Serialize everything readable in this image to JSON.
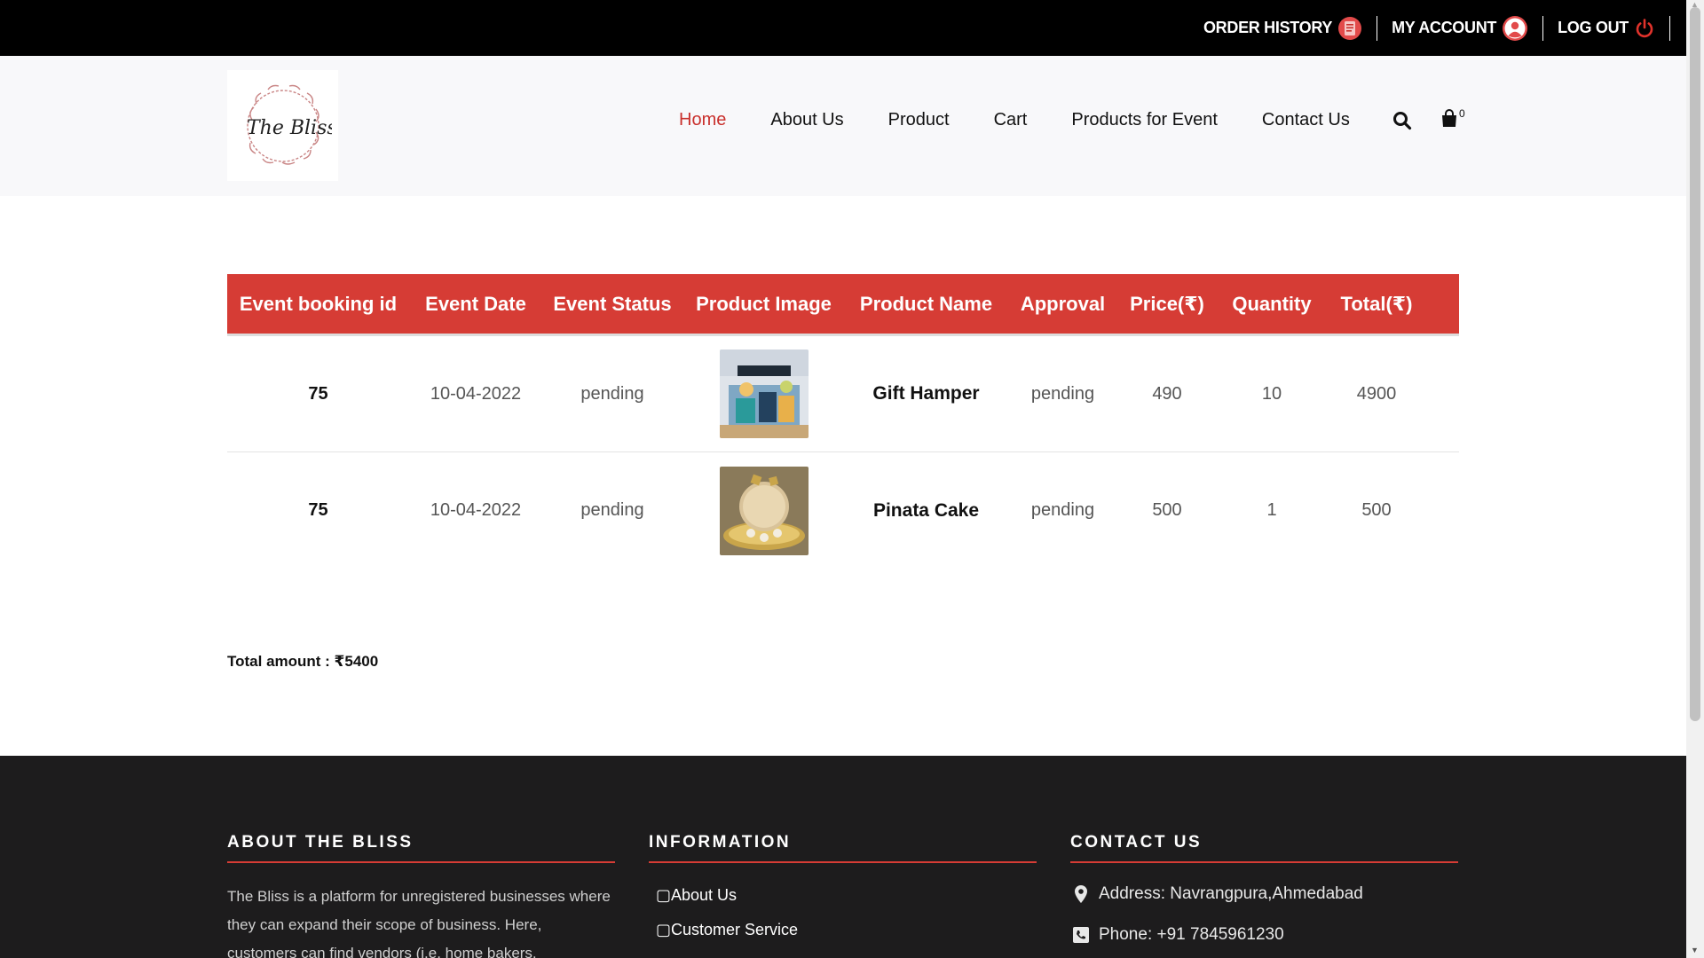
{
  "top_links": [
    {
      "label": "ORDER HISTORY",
      "icon": "order-history-icon"
    },
    {
      "label": "MY ACCOUNT",
      "icon": "user-account-icon"
    },
    {
      "label": "LOG OUT",
      "icon": "power-icon"
    }
  ],
  "logo": {
    "text": "The Bliss"
  },
  "nav": [
    {
      "label": "Home",
      "active": true
    },
    {
      "label": "About Us",
      "active": false
    },
    {
      "label": "Product",
      "active": false
    },
    {
      "label": "Cart",
      "active": false
    },
    {
      "label": "Products for Event",
      "active": false
    },
    {
      "label": "Contact Us",
      "active": false
    }
  ],
  "cart": {
    "count": "0"
  },
  "table": {
    "headers": [
      "Event booking id",
      "Event Date",
      "Event Status",
      "Product Image",
      "Product Name",
      "Approval",
      "Price(₹)",
      "Quantity",
      "Total(₹)"
    ],
    "rows": [
      {
        "id": "75",
        "date": "10-04-2022",
        "status": "pending",
        "image": "gift-hamper-image",
        "name": "Gift Hamper",
        "approval": "pending",
        "price": "490",
        "quantity": "10",
        "total": "4900"
      },
      {
        "id": "75",
        "date": "10-04-2022",
        "status": "pending",
        "image": "pinata-cake-image",
        "name": "Pinata Cake",
        "approval": "pending",
        "price": "500",
        "quantity": "1",
        "total": "500"
      }
    ]
  },
  "total_amount": "Total amount : ₹5400",
  "footer": {
    "about": {
      "title": "ABOUT THE BLISS",
      "text": "The Bliss is a platform for unregistered businesses where they can expand their scope of business. Here, customers can find vendors (i.e. home bakers, Decorators, Snacks"
    },
    "information": {
      "title": "INFORMATION",
      "items": [
        "About Us",
        "Customer Service"
      ]
    },
    "contact": {
      "title": "CONTACT US",
      "address": "Address: Navrangpura,Ahmedabad",
      "phone": "Phone: +91 7845961230"
    }
  },
  "colors": {
    "accent": "#d63c35",
    "topbar": "#000000",
    "footer": "#1d1c1d",
    "active_nav": "#c9302c"
  }
}
